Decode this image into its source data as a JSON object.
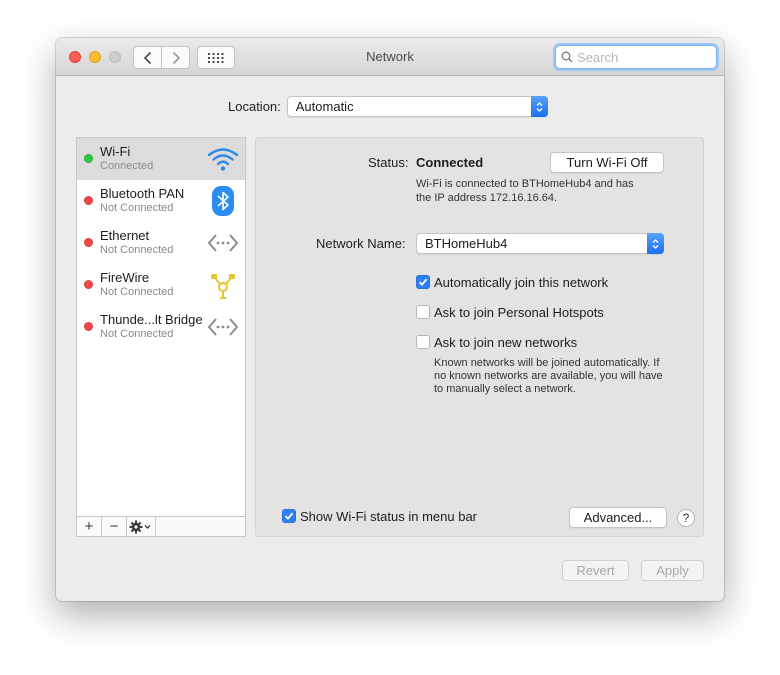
{
  "window": {
    "title": "Network",
    "search_placeholder": "Search"
  },
  "location": {
    "label": "Location:",
    "value": "Automatic"
  },
  "services": [
    {
      "name": "Wi-Fi",
      "status": "Connected",
      "status_color": "#2dc840",
      "icon": "wifi-icon"
    },
    {
      "name": "Bluetooth PAN",
      "status": "Not Connected",
      "status_color": "#f24a4a",
      "icon": "bluetooth-icon"
    },
    {
      "name": "Ethernet",
      "status": "Not Connected",
      "status_color": "#f24a4a",
      "icon": "ethernet-icon"
    },
    {
      "name": "FireWire",
      "status": "Not Connected",
      "status_color": "#f24a4a",
      "icon": "firewire-icon"
    },
    {
      "name": "Thunde...lt Bridge",
      "status": "Not Connected",
      "status_color": "#f24a4a",
      "icon": "thunderbolt-bridge-icon"
    }
  ],
  "sidebar_toolbar": {
    "add": "+",
    "remove": "−"
  },
  "detail": {
    "status_label": "Status:",
    "status_value": "Connected",
    "turn_off_button": "Turn Wi-Fi Off",
    "status_description_line1": "Wi-Fi is connected to BTHomeHub4 and has",
    "status_description_line2": "the IP address 172.16.16.64.",
    "network_name_label": "Network Name:",
    "network_name_value": "BTHomeHub4",
    "options": [
      {
        "label": "Automatically join this network",
        "checked": true
      },
      {
        "label": "Ask to join Personal Hotspots",
        "checked": false
      },
      {
        "label": "Ask to join new networks",
        "checked": false
      }
    ],
    "known_networks_note_line1": "Known networks will be joined automatically. If",
    "known_networks_note_line2": "no known networks are available, you will have",
    "known_networks_note_line3": "to manually select a network.",
    "show_status_label": "Show Wi-Fi status in menu bar",
    "show_status_checked": true,
    "advanced_button": "Advanced...",
    "help_button": "?"
  },
  "footer": {
    "revert_button": "Revert",
    "apply_button": "Apply"
  },
  "colors": {
    "accent": "#2f7ff5",
    "connected": "#2dc840",
    "disconnected": "#f24a4a"
  }
}
